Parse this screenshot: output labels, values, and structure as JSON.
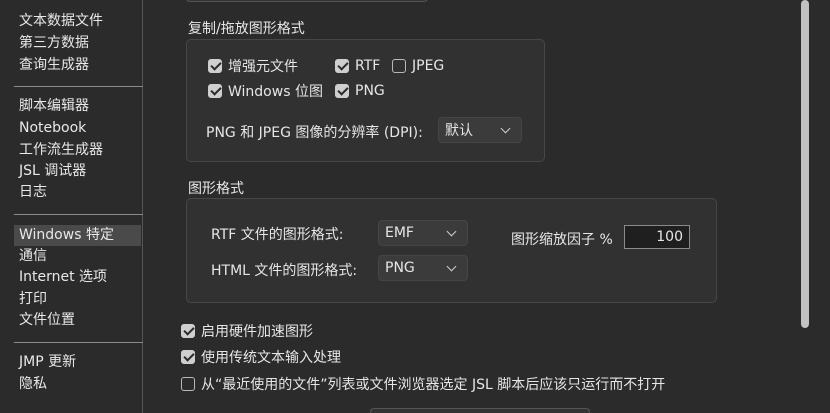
{
  "sidebar": {
    "group1": [
      "文本数据文件",
      "第三方数据",
      "查询生成器"
    ],
    "group2": [
      "脚本编辑器",
      "Notebook",
      "工作流生成器",
      "JSL 调试器",
      "日志"
    ],
    "group3": [
      "Windows 特定",
      "通信",
      "Internet 选项",
      "打印",
      "文件位置"
    ],
    "group4": [
      "JMP 更新",
      "隐私"
    ],
    "selected": "Windows 特定"
  },
  "copy_drag": {
    "title": "复制/拖放图形格式",
    "options": [
      {
        "label": "增强元文件",
        "checked": true
      },
      {
        "label": "RTF",
        "checked": true
      },
      {
        "label": "JPEG",
        "checked": false
      },
      {
        "label": "Windows 位图",
        "checked": true
      },
      {
        "label": "PNG",
        "checked": true
      }
    ],
    "resolution_label": "PNG 和 JPEG 图像的分辨率 (DPI):",
    "resolution_value": "默认"
  },
  "graphics_format": {
    "title": "图形格式",
    "rtf_label": "RTF 文件的图形格式:",
    "rtf_value": "EMF",
    "html_label": "HTML 文件的图形格式:",
    "html_value": "PNG",
    "scale_label": "图形缩放因子 %",
    "scale_value": "100"
  },
  "options": [
    {
      "label": "启用硬件加速图形",
      "checked": true
    },
    {
      "label": "使用传统文本输入处理",
      "checked": true
    },
    {
      "label": "从“最近使用的文件”列表或文件浏览器选定 JSL 脚本后应该只运行而不打开",
      "checked": false
    }
  ]
}
